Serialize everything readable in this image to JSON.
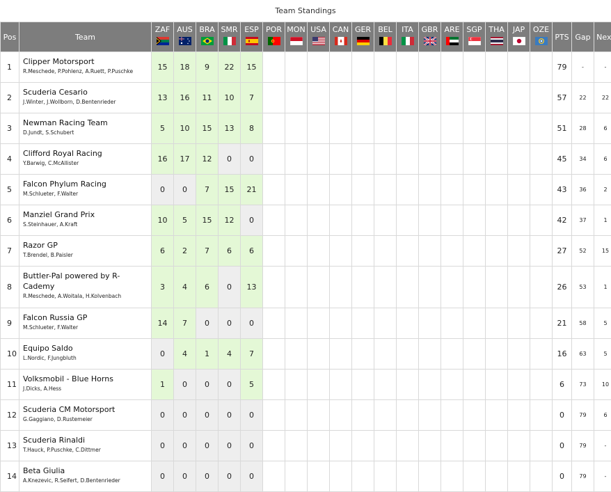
{
  "title": "Team Standings",
  "headers": {
    "pos": "Pos",
    "team": "Team",
    "pts": "PTS",
    "gap": "Gap",
    "next": "Next"
  },
  "races": [
    {
      "code": "ZAF",
      "flag": "south-africa-flag"
    },
    {
      "code": "AUS",
      "flag": "australia-flag"
    },
    {
      "code": "BRA",
      "flag": "brazil-flag"
    },
    {
      "code": "SMR",
      "flag": "italy-flag"
    },
    {
      "code": "ESP",
      "flag": "spain-flag"
    },
    {
      "code": "POR",
      "flag": "portugal-flag"
    },
    {
      "code": "MON",
      "flag": "monaco-flag"
    },
    {
      "code": "USA",
      "flag": "usa-flag"
    },
    {
      "code": "CAN",
      "flag": "canada-flag"
    },
    {
      "code": "GER",
      "flag": "germany-flag"
    },
    {
      "code": "BEL",
      "flag": "belgium-flag"
    },
    {
      "code": "ITA",
      "flag": "italy-flag"
    },
    {
      "code": "GBR",
      "flag": "uk-flag"
    },
    {
      "code": "ARE",
      "flag": "uae-flag"
    },
    {
      "code": "SGP",
      "flag": "singapore-flag"
    },
    {
      "code": "THA",
      "flag": "thailand-flag"
    },
    {
      "code": "JAP",
      "flag": "japan-flag"
    },
    {
      "code": "OZE",
      "flag": "oceania-flag"
    }
  ],
  "colors": {
    "header_bg": "#7d7d7d",
    "scored_bg": "#e4f8d6",
    "zero_bg": "#eeeeee"
  },
  "rows": [
    {
      "pos": "1",
      "team": "Clipper Motorsport",
      "drivers": "R.Meschede, P.Pohlenz, A.Ruett, P.Puschke",
      "results": [
        "15",
        "18",
        "9",
        "22",
        "15"
      ],
      "pts": "79",
      "gap": "-",
      "next": "-"
    },
    {
      "pos": "2",
      "team": "Scuderia Cesario",
      "drivers": "J.Winter, J.Wollborn, D.Bentenrieder",
      "results": [
        "13",
        "16",
        "11",
        "10",
        "7"
      ],
      "pts": "57",
      "gap": "22",
      "next": "22"
    },
    {
      "pos": "3",
      "team": "Newman Racing Team",
      "drivers": "D.Jundt, S.Schubert",
      "results": [
        "5",
        "10",
        "15",
        "13",
        "8"
      ],
      "pts": "51",
      "gap": "28",
      "next": "6"
    },
    {
      "pos": "4",
      "team": "Clifford Royal Racing",
      "drivers": "Y.Barwig, C.McAllister",
      "results": [
        "16",
        "17",
        "12",
        "0",
        "0"
      ],
      "pts": "45",
      "gap": "34",
      "next": "6"
    },
    {
      "pos": "5",
      "team": "Falcon Phylum Racing",
      "drivers": "M.Schlueter, F.Walter",
      "results": [
        "0",
        "0",
        "7",
        "15",
        "21"
      ],
      "pts": "43",
      "gap": "36",
      "next": "2"
    },
    {
      "pos": "6",
      "team": "Manziel Grand Prix",
      "drivers": "S.Steinhauer, A.Kraft",
      "results": [
        "10",
        "5",
        "15",
        "12",
        "0"
      ],
      "pts": "42",
      "gap": "37",
      "next": "1"
    },
    {
      "pos": "7",
      "team": "Razor GP",
      "drivers": "T.Brendel, B.Paisler",
      "results": [
        "6",
        "2",
        "7",
        "6",
        "6"
      ],
      "pts": "27",
      "gap": "52",
      "next": "15"
    },
    {
      "pos": "8",
      "team": "Buttler-Pal powered by R-Cademy",
      "drivers": "R.Meschede, A.Woitala, H.Kolvenbach",
      "results": [
        "3",
        "4",
        "6",
        "0",
        "13"
      ],
      "pts": "26",
      "gap": "53",
      "next": "1",
      "tall": true
    },
    {
      "pos": "9",
      "team": "Falcon Russia GP",
      "drivers": "M.Schlueter, F.Walter",
      "results": [
        "14",
        "7",
        "0",
        "0",
        "0"
      ],
      "pts": "21",
      "gap": "58",
      "next": "5"
    },
    {
      "pos": "10",
      "team": "Equipo Saldo",
      "drivers": "L.Nordic, F.Jungbluth",
      "results": [
        "0",
        "4",
        "1",
        "4",
        "7"
      ],
      "pts": "16",
      "gap": "63",
      "next": "5"
    },
    {
      "pos": "11",
      "team": "Volksmobil - Blue Horns",
      "drivers": "J.Dicks, A.Hess",
      "results": [
        "1",
        "0",
        "0",
        "0",
        "5"
      ],
      "pts": "6",
      "gap": "73",
      "next": "10"
    },
    {
      "pos": "12",
      "team": "Scuderia CM Motorsport",
      "drivers": "G.Gaggiano, D.Rustemeier",
      "results": [
        "0",
        "0",
        "0",
        "0",
        "0"
      ],
      "pts": "0",
      "gap": "79",
      "next": "6"
    },
    {
      "pos": "13",
      "team": "Scuderia Rinaldi",
      "drivers": "T.Hauck, P.Puschke, C.Dittmer",
      "results": [
        "0",
        "0",
        "0",
        "0",
        "0"
      ],
      "pts": "0",
      "gap": "79",
      "next": "-"
    },
    {
      "pos": "14",
      "team": "Beta Giulia",
      "drivers": "A.Knezevic, R.Seifert, D.Bentenrieder",
      "results": [
        "0",
        "0",
        "0",
        "0",
        "0"
      ],
      "pts": "0",
      "gap": "79",
      "next": "-"
    }
  ]
}
